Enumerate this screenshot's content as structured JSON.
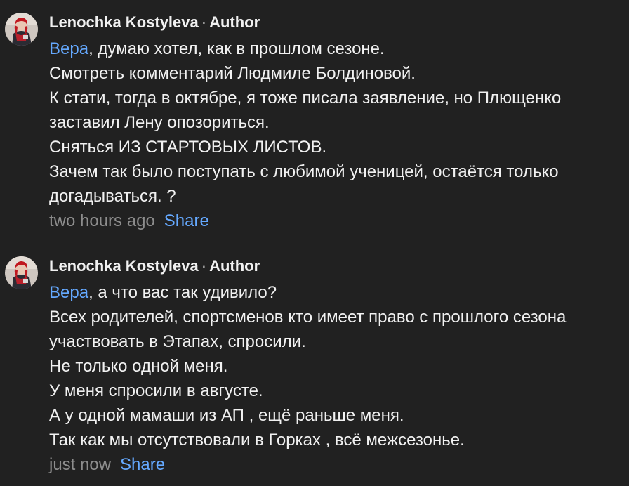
{
  "comments": [
    {
      "author": "Lenochka Kostyleva",
      "separator": "·",
      "role": "Author",
      "mention": "Вера",
      "lines": [
        ", думаю хотел, как в прошлом сезоне.",
        "Смотреть комментарий Людмиле Болдиновой.",
        "К стати, тогда в октябре, я тоже писала заявление, но Плющенко",
        "заставил Лену опозориться.",
        "Сняться ИЗ СТАРТОВЫХ ЛИСТОВ.",
        "Зачем так было поступать с любимой ученицей, остаётся только",
        "догадываться. ?"
      ],
      "time": "two hours ago",
      "share_label": "Share"
    },
    {
      "author": "Lenochka Kostyleva",
      "separator": "·",
      "role": "Author",
      "mention": "Вера",
      "lines": [
        ", а что вас так удивило?",
        "Всех родителей, спортсменов кто имеет право с прошлого сезона",
        "участвовать в Этапах, спросили.",
        "Не только одной меня.",
        "У меня спросили в августе.",
        "А у одной мамаши из АП , ещё раньше меня.",
        "Так как мы отсутствовали в Горках , всё межсезонье."
      ],
      "time": "just now",
      "share_label": "Share"
    }
  ],
  "colors": {
    "background": "#212121",
    "text": "#f1f1f1",
    "link": "#65a9ff",
    "muted": "#8d8d8d"
  },
  "icons": {
    "avatar": "user-avatar-photo"
  }
}
